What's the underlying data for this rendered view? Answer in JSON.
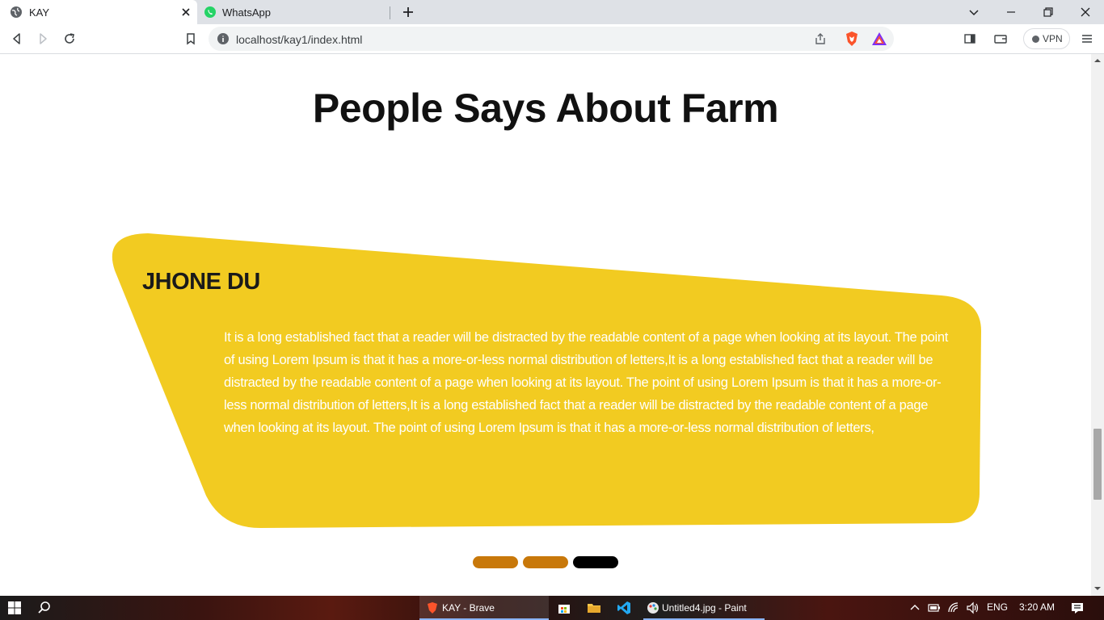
{
  "browser": {
    "tabs": [
      {
        "title": "KAY",
        "active": true
      },
      {
        "title": "WhatsApp",
        "active": false
      }
    ],
    "url": "localhost/kay1/index.html",
    "vpn_label": "VPN"
  },
  "page": {
    "heading": "People Says About Farm",
    "testimonial": {
      "name": "JHONE DU",
      "text": "It is a long established fact that a reader will be distracted by the readable content of a page when looking at its layout. The point of using Lorem Ipsum is that it has a more-or-less normal distribution of letters,It is a long established fact that a reader will be distracted by the readable content of a page when looking at its layout. The point of using Lorem Ipsum is that it has a more-or-less normal distribution of letters,It is a long established fact that a reader will be distracted by the readable content of a page when looking at its layout. The point of using Lorem Ipsum is that it has a more-or-less normal distribution of letters,"
    },
    "carousel": {
      "count": 3,
      "active_index": 2
    },
    "colors": {
      "card": "#f2cb21",
      "indicator": "#c8780a",
      "indicator_active": "#000000"
    }
  },
  "taskbar": {
    "apps": [
      {
        "label": "KAY - Brave"
      },
      {
        "label": "Untitled4.jpg - Paint"
      }
    ],
    "language": "ENG",
    "time": "3:20 AM"
  }
}
